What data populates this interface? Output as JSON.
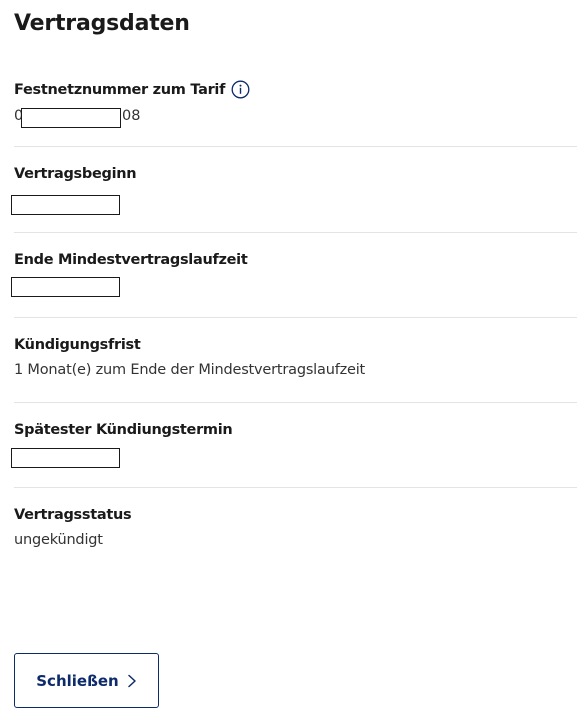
{
  "page": {
    "title": "Vertragsdaten"
  },
  "fields": [
    {
      "label": "Festnetznummer zum Tarif",
      "value_prefix": "0",
      "value_suffix": "08"
    },
    {
      "label": "Vertragsbeginn",
      "value": ""
    },
    {
      "label": "Ende Mindestvertragslaufzeit",
      "value": ""
    },
    {
      "label": "Kündigungsfrist",
      "value": "1 Monat(e) zum Ende der Mindestvertragslaufzeit"
    },
    {
      "label": "Spätester Kündiungstermin",
      "value": ""
    },
    {
      "label": "Vertragsstatus",
      "value": "ungekündigt"
    }
  ],
  "icons": {
    "info": "info-circle-icon",
    "chevron": "chevron-right-icon"
  },
  "colors": {
    "accent": "#0d2a6b",
    "text": "#1a1a1a",
    "divider": "#e3e3e3"
  },
  "actions": {
    "close_label": "Schließen"
  }
}
